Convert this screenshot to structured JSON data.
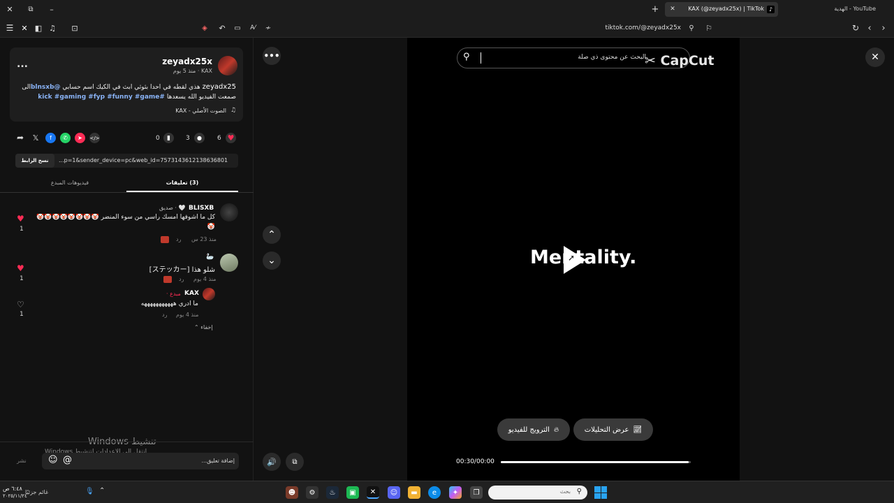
{
  "titlebar": {
    "tab_active": "KAX (@zeyadx25x) | TikTok",
    "tab_other": "YouTube - الهدية",
    "new_tab": "+",
    "close_tab": "✕",
    "win_close": "✕",
    "win_restore": "⧉",
    "win_min": "–"
  },
  "toolbar": {
    "url": "tiktok.com/@zeyadx25x"
  },
  "post": {
    "username": "zeyadx25x",
    "subline": "KAX · منذ 5 يوم",
    "caption_line1_user": "zeyadx25",
    "caption_line1": "هذي لقطه في احدا بثوثي ابث في الكيك اسم حسابي",
    "caption_mention": "@blnsxb",
    "caption_line1_end": "الى صمعت",
    "caption_line2": "الفيديو الله يسعدها",
    "caption_tags": "#kick #gaming #fyp #funny #game",
    "sound": "الصوت الأصلي - KAX",
    "more": "...",
    "likes": "6",
    "comments": "3",
    "saves": "0",
    "link_value": "...p=1&sender_device=pc&web_id=7573143612138636801",
    "copy_link": "نسخ الرابط"
  },
  "tabs": {
    "comments": "(3) تعليقات",
    "creator_videos": "فيديوهات المبدع"
  },
  "comments": [
    {
      "author": "BLISXB",
      "badge": "🤍 · صديق",
      "text": "كل ما اشوفها أمسك راسي من سوء المنضر 🤡🤡🤡🤡🤡🤡🤡🤡",
      "text2": "🤡",
      "time": "منذ 23 س",
      "reply": "رد",
      "likes": "1"
    },
    {
      "author": "🦢",
      "text": "شلو هذا [ステッカー]",
      "time": "منذ 4 يوم",
      "reply": "رد",
      "likes": "1"
    },
    {
      "author": "KAX",
      "badge": "مبدع ·",
      "text": "ما ادري هههههههههههه",
      "time": "منذ 4 يوم",
      "reply": "رد",
      "likes": "1"
    }
  ],
  "hide_label": "إخفاء",
  "activation": {
    "title": "تنشيط Windows",
    "sub": "انتقل إلى الإعدادات لتنشيط Windows"
  },
  "comment_input": {
    "placeholder": "إضافة تعليق...",
    "post": "نشر"
  },
  "video": {
    "search_placeholder": "البحث عن محتوى ذي صلة",
    "watermark": "CapCut",
    "center_text": "Mentality.",
    "promote": "الترويج للفيديو",
    "analytics": "عرض التحليلات",
    "time": "00:30/00:00",
    "progress": 0.99
  },
  "taskbar": {
    "search_placeholder": "بحث",
    "clock": "٦:٤٨ ص",
    "date": "٢٠٢٥/١١/٢٤",
    "weather": "غائم جزئيًا"
  },
  "colors": {
    "accent_pink": "#fe2c55",
    "link_blue": "#8ab4f8"
  }
}
